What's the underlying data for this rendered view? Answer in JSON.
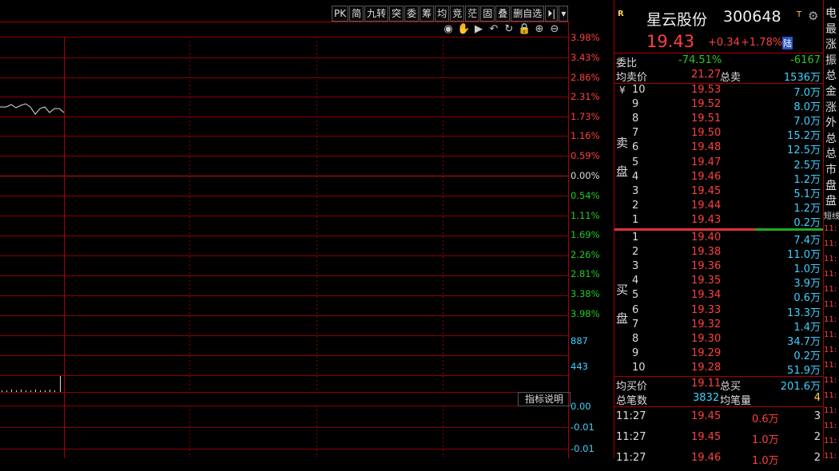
{
  "toolbar": [
    "PK",
    "简",
    "九转",
    "突",
    "委",
    "筹",
    "均",
    "竞",
    "茫",
    "固",
    "叠",
    "删自选",
    "⏵|",
    "▾"
  ],
  "iconbar": [
    "eye-icon",
    "hand-icon",
    "play-icon",
    "undo-icon",
    "refresh-icon",
    "lock-icon",
    "zoom-in-icon",
    "zoom-out-icon"
  ],
  "iconglyphs": [
    "◉",
    "✋",
    "▶",
    "↶",
    "↻",
    "🔒",
    "⊕",
    "⊖"
  ],
  "axis": {
    "price_pct": [
      "3.98%",
      "3.43%",
      "2.86%",
      "2.31%",
      "1.73%",
      "1.16%",
      "0.59%",
      "0.00%",
      "0.54%",
      "1.11%",
      "1.69%",
      "2.26%",
      "2.81%",
      "3.38%",
      "3.98%"
    ],
    "volume": [
      "887",
      "443"
    ],
    "indicator": [
      "0.00",
      "-0.01",
      "-0.01"
    ]
  },
  "indicator_button": "指标说明",
  "stock": {
    "r_badge": "R",
    "name": "星云股份",
    "code": "300648",
    "t_badge": "T",
    "price": "19.43",
    "change": "+0.34",
    "change_pct": "+1.78%",
    "market_badge": "陆"
  },
  "summary": {
    "weibi_label": "委比",
    "weibi_value": "-74.51%",
    "weicha_value": "-6167",
    "avg_sell_label": "均卖价",
    "avg_sell_price": "21.27",
    "total_sell_label": "总卖",
    "total_sell_value": "1536万",
    "avg_buy_label": "均买价",
    "avg_buy_price": "19.11",
    "total_buy_label": "总买",
    "total_buy_value": "201.6万",
    "total_trades_label": "总笔数",
    "total_trades_value": "3832",
    "avg_trade_label": "均笔量",
    "avg_trade_value": "4"
  },
  "sell_label": [
    "卖",
    "盘"
  ],
  "buy_label": [
    "买",
    "盘"
  ],
  "yen": "¥",
  "sell": [
    {
      "level": "10",
      "price": "19.53",
      "vol": "7.0万"
    },
    {
      "level": "9",
      "price": "19.52",
      "vol": "8.0万"
    },
    {
      "level": "8",
      "price": "19.51",
      "vol": "7.0万"
    },
    {
      "level": "7",
      "price": "19.50",
      "vol": "15.2万"
    },
    {
      "level": "6",
      "price": "19.48",
      "vol": "12.5万"
    },
    {
      "level": "5",
      "price": "19.47",
      "vol": "2.5万"
    },
    {
      "level": "4",
      "price": "19.46",
      "vol": "1.2万"
    },
    {
      "level": "3",
      "price": "19.45",
      "vol": "5.1万"
    },
    {
      "level": "2",
      "price": "19.44",
      "vol": "1.2万"
    },
    {
      "level": "1",
      "price": "19.43",
      "vol": "0.2万"
    }
  ],
  "buy": [
    {
      "level": "1",
      "price": "19.40",
      "vol": "7.4万"
    },
    {
      "level": "2",
      "price": "19.38",
      "vol": "11.0万"
    },
    {
      "level": "3",
      "price": "19.36",
      "vol": "1.0万"
    },
    {
      "level": "4",
      "price": "19.35",
      "vol": "3.9万"
    },
    {
      "level": "5",
      "price": "19.34",
      "vol": "0.6万"
    },
    {
      "level": "6",
      "price": "19.33",
      "vol": "13.3万"
    },
    {
      "level": "7",
      "price": "19.32",
      "vol": "1.4万"
    },
    {
      "level": "8",
      "price": "19.30",
      "vol": "34.7万"
    },
    {
      "level": "9",
      "price": "19.29",
      "vol": "0.2万"
    },
    {
      "level": "10",
      "price": "19.28",
      "vol": "51.9万"
    }
  ],
  "ticks": [
    {
      "time": "11:27",
      "price": "19.45",
      "vol": "0.6万",
      "n": "3"
    },
    {
      "time": "11:27",
      "price": "19.45",
      "vol": "1.0万",
      "n": "2"
    },
    {
      "time": "11:27",
      "price": "19.46",
      "vol": "1.0万",
      "n": "2"
    }
  ],
  "far_right": [
    "电",
    "最",
    "涨",
    "振",
    "总",
    "金",
    "涨",
    "外",
    "总",
    "总",
    "市",
    "盘",
    "盘"
  ],
  "far_right_small": [
    "短线",
    "11:",
    "11:",
    "11:",
    "11:",
    "11:",
    "11:",
    "11:",
    "11:",
    "11:",
    "11:",
    "11:",
    "11:",
    "11:",
    "11:",
    "11:",
    "11:"
  ]
}
